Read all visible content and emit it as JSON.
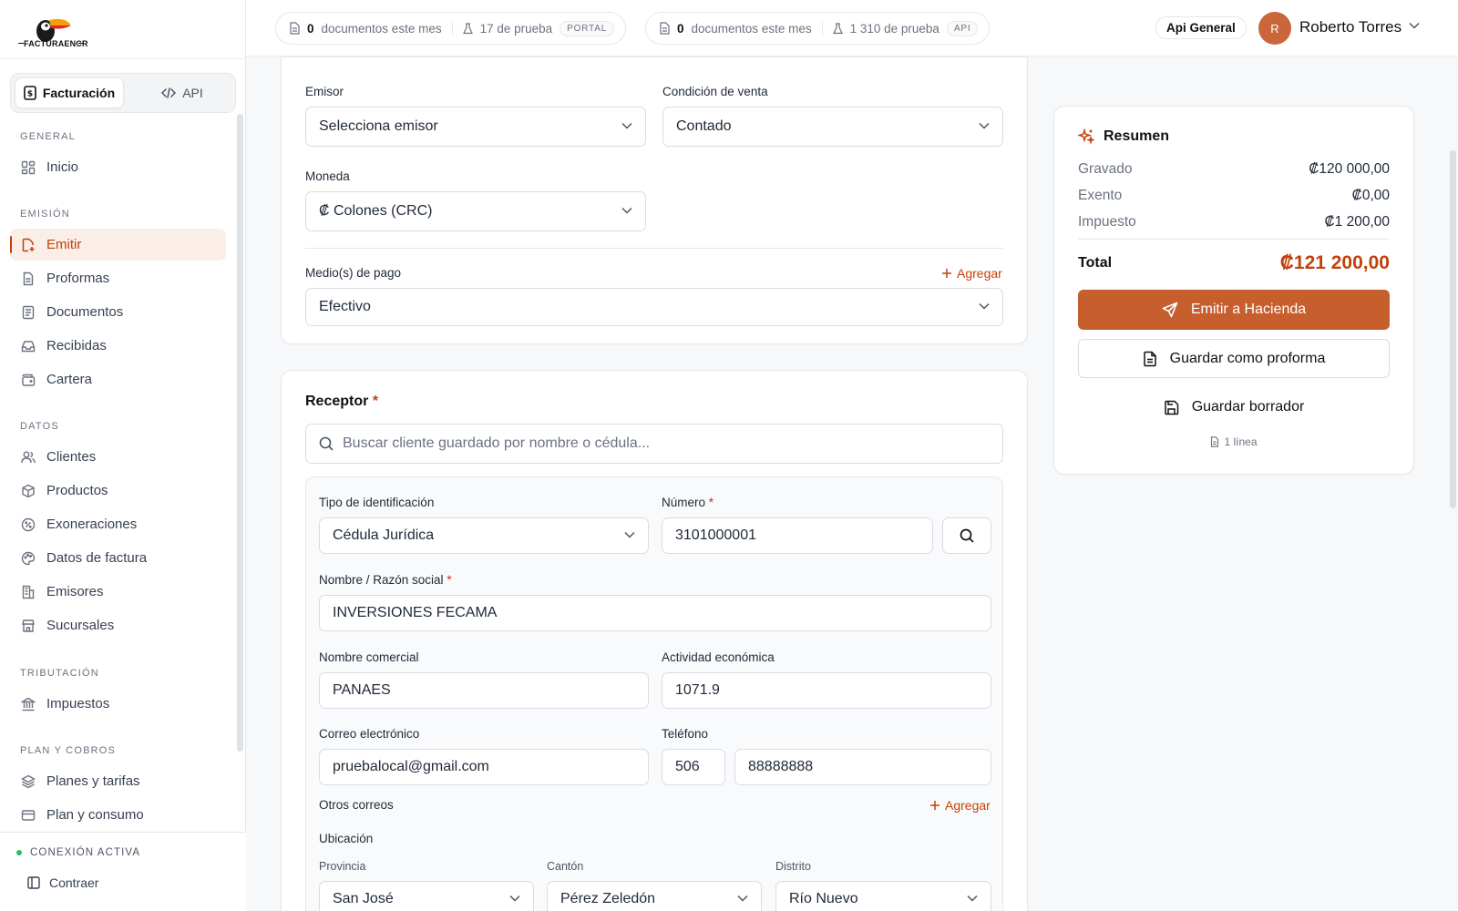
{
  "brand": {
    "name": "FACTURAENCR"
  },
  "sidebar": {
    "mode_tabs": [
      {
        "label": "Facturación",
        "icon": "invoice-icon"
      },
      {
        "label": "API",
        "icon": "code-icon"
      }
    ],
    "sections": {
      "general": "GENERAL",
      "emision": "EMISIÓN",
      "datos": "DATOS",
      "tributacion": "TRIBUTACIÓN",
      "plan": "PLAN Y COBROS"
    },
    "items": {
      "inicio": "Inicio",
      "emitir": "Emitir",
      "proformas": "Proformas",
      "documentos": "Documentos",
      "recibidas": "Recibidas",
      "cartera": "Cartera",
      "clientes": "Clientes",
      "productos": "Productos",
      "exoneraciones": "Exoneraciones",
      "datos_factura": "Datos de factura",
      "emisores": "Emisores",
      "sucursales": "Sucursales",
      "impuestos": "Impuestos",
      "planes": "Planes y tarifas",
      "consumo": "Plan y consumo"
    },
    "active_item": "Emitir",
    "connection_status": "CONEXIÓN ACTIVA",
    "collapse_label": "Contraer"
  },
  "topbar": {
    "usage_portal": {
      "count": "0",
      "docs_text": "documentos este mes",
      "tests": "17 de prueba",
      "tag": "PORTAL"
    },
    "usage_api": {
      "count": "0",
      "docs_text": "documentos este mes",
      "tests": "1 310 de prueba",
      "tag": "API"
    },
    "api_badge": "Api General",
    "user": {
      "initial": "R",
      "name": "Roberto Torres"
    }
  },
  "general_card": {
    "emisor": {
      "label": "Emisor",
      "value": "Selecciona emisor"
    },
    "condicion": {
      "label": "Condición de venta",
      "value": "Contado"
    },
    "moneda": {
      "label": "Moneda",
      "value": "₡ Colones (CRC)"
    },
    "medio_pago": {
      "label": "Medio(s) de pago",
      "value": "Efectivo",
      "add_label": "Agregar"
    }
  },
  "receptor": {
    "title": "Receptor",
    "required_mark": "*",
    "search_placeholder": "Buscar cliente guardado por nombre o cédula...",
    "tipo_id": {
      "label": "Tipo de identificación",
      "value": "Cédula Jurídica"
    },
    "numero": {
      "label": "Número",
      "value": "3101000001"
    },
    "nombre": {
      "label": "Nombre / Razón social",
      "value": "INVERSIONES FECAMA"
    },
    "comercial": {
      "label": "Nombre comercial",
      "value": "PANAES"
    },
    "actividad": {
      "label": "Actividad económica",
      "value": "1071.9"
    },
    "correo": {
      "label": "Correo electrónico",
      "value": "pruebalocal@gmail.com"
    },
    "telefono": {
      "label": "Teléfono",
      "code": "506",
      "number": "88888888"
    },
    "otros_correos": {
      "label": "Otros correos",
      "add_label": "Agregar"
    },
    "ubicacion": {
      "label": "Ubicación",
      "provincia": {
        "label": "Provincia",
        "value": "San José"
      },
      "canton": {
        "label": "Cantón",
        "value": "Pérez Zeledón"
      },
      "distrito": {
        "label": "Distrito",
        "value": "Río Nuevo"
      }
    }
  },
  "summary": {
    "title": "Resumen",
    "rows": [
      {
        "label": "Gravado",
        "value": "₡120 000,00"
      },
      {
        "label": "Exento",
        "value": "₡0,00"
      },
      {
        "label": "Impuesto",
        "value": "₡1 200,00"
      }
    ],
    "total_label": "Total",
    "total_value": "₡121 200,00",
    "emit_button": "Emitir a Hacienda",
    "proforma_button": "Guardar como proforma",
    "draft_button": "Guardar borrador",
    "lines_note": "1 línea"
  },
  "colors": {
    "accent": "#c75e2e",
    "accent_text": "#c2410c",
    "active_bg": "#fbeee6",
    "status_ok": "#22c55e"
  }
}
